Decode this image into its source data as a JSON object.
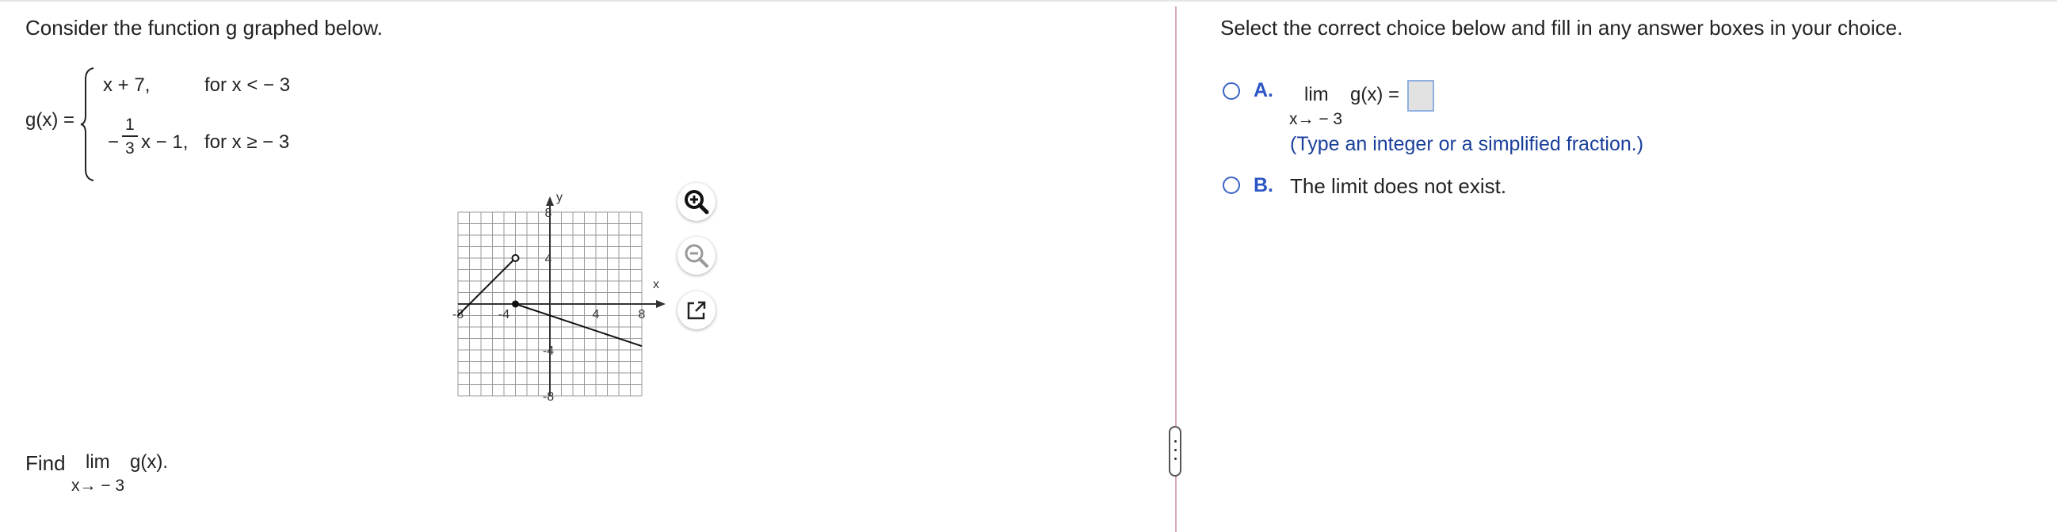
{
  "left": {
    "intro": "Consider the function g graphed below.",
    "func_name": "g(x) =",
    "piece1_expr": "x + 7,",
    "piece1_cond": "for x <  − 3",
    "piece2_minus": "−",
    "piece2_num": "1",
    "piece2_den": "3",
    "piece2_rest": "x − 1,",
    "piece2_cond": "for x ≥  − 3",
    "find_label": "Find",
    "find_lim": "lim",
    "find_func": "g(x).",
    "find_sub": "x→ − 3"
  },
  "graph": {
    "x_label": "x",
    "y_label": "y",
    "tick_labels": [
      "-8",
      "-4",
      "4",
      "8",
      "8",
      "4",
      "-4",
      "-8"
    ]
  },
  "graph_tools": {
    "zoom_in_icon": "zoom-in-icon",
    "zoom_out_icon": "zoom-out-icon",
    "popout_icon": "external-window-icon"
  },
  "right": {
    "instructions": "Select the correct choice below and fill in any answer boxes in your choice.",
    "choiceA_letter": "A.",
    "choiceA_lim": "lim",
    "choiceA_func": "g(x) =",
    "choiceA_sub": "x→ − 3",
    "choiceA_hint": "(Type an integer or a simplified fraction.)",
    "choiceB_letter": "B.",
    "choiceB_text": "The limit does not exist."
  },
  "colors": {
    "accent": "#3b64c8",
    "hint": "#1a3f9a",
    "divider": "#d8a7ba"
  }
}
